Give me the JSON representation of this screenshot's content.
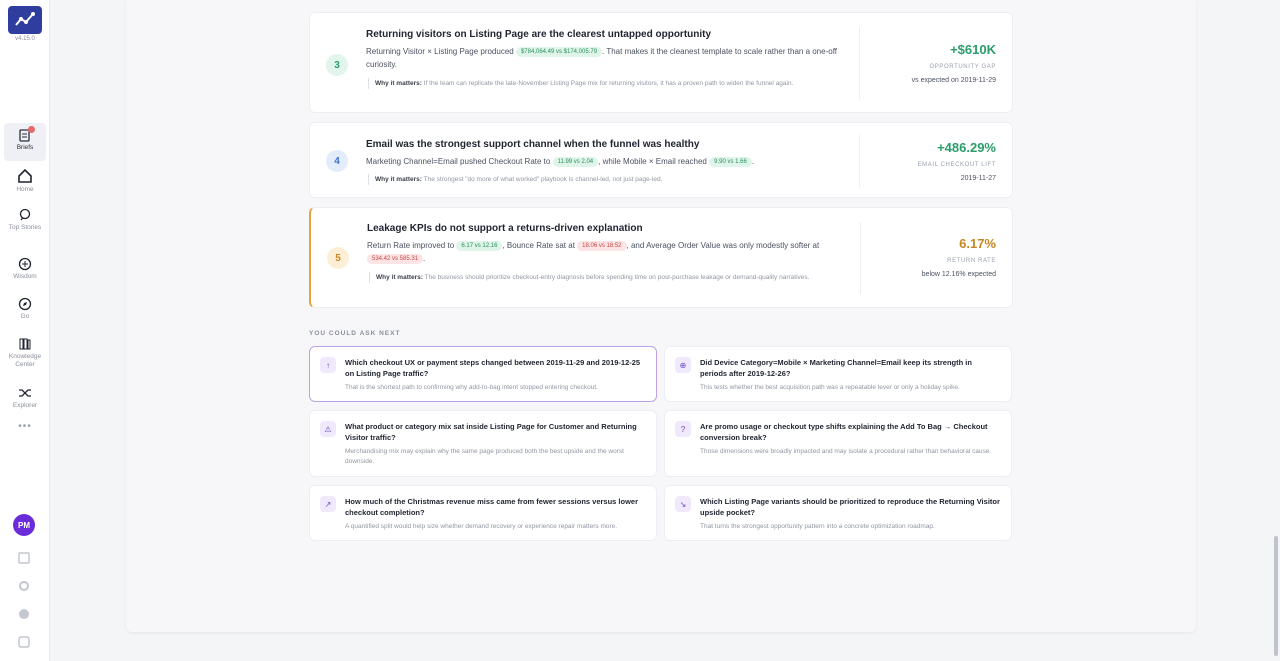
{
  "app": {
    "version": "v4.15.0",
    "user_initials": "PM"
  },
  "nav": [
    {
      "label": "Briefs",
      "icon": "briefs-icon"
    },
    {
      "label": "Home",
      "icon": "home-icon"
    },
    {
      "label": "Top Stories",
      "icon": "top-stories-icon"
    },
    {
      "label": "Wisdom",
      "icon": "wisdom-icon"
    },
    {
      "label": "Go",
      "icon": "compass-icon"
    },
    {
      "label": "Knowledge Center",
      "icon": "knowledge-center-icon"
    },
    {
      "label": "Explorer",
      "icon": "shuffle-icon"
    }
  ],
  "findings": [
    {
      "num": "3",
      "title": "Returning visitors on Listing Page are the clearest untapped opportunity",
      "body_a": "Returning Visitor × Listing Page produced",
      "pill_a": "$784,064.49 vs $174,005.79",
      "body_b": ". That makes it the cleanest template to scale rather than a one-off curiosity.",
      "why_label": "Why it matters:",
      "why_text": "If the team can replicate the late-November Listing Page mix for returning visitors, it has a proven path to widen the funnel again.",
      "metric_value": "+$610K",
      "metric_label": "OPPORTUNITY GAP",
      "metric_sub": "vs expected on 2019-11-29",
      "color": "#2a9d6a"
    },
    {
      "num": "4",
      "title": "Email was the strongest support channel when the funnel was healthy",
      "body_a": "Marketing Channel=Email pushed Checkout Rate to",
      "pill_a": "11.99 vs 2.04",
      "body_b": ", while Mobile × Email reached",
      "pill_b": "9.90 vs 1.66",
      "body_c": ".",
      "why_label": "Why it matters:",
      "why_text": "The strongest \"do more of what worked\" playbook is channel-led, not just page-led.",
      "metric_value": "+486.29%",
      "metric_label": "EMAIL CHECKOUT LIFT",
      "metric_sub": "2019-11-27",
      "color": "#2a9d6a"
    },
    {
      "num": "5",
      "title": "Leakage KPIs do not support a returns-driven explanation",
      "body_a": "Return Rate improved to",
      "pill_a": "6.17 vs 12.16",
      "body_b": ", Bounce Rate sat at",
      "pill_b": "18.06 vs 18.52",
      "body_c": ", and Average Order Value was only modestly softer at",
      "pill_c": "534.42 vs 585.31",
      "body_d": ".",
      "why_label": "Why it matters:",
      "why_text": "The business should prioritize checkout-entry diagnosis before spending time on post-purchase leakage or demand-quality narratives.",
      "metric_value": "6.17%",
      "metric_label": "RETURN RATE",
      "metric_sub": "below 12.16% expected",
      "color": "#c78620"
    }
  ],
  "ask_next": {
    "heading": "YOU COULD ASK NEXT",
    "questions": [
      {
        "icon": "↑",
        "title": "Which checkout UX or payment steps changed between 2019-11-29 and 2019-12-25 on Listing Page traffic?",
        "sub": "That is the shortest path to confirming why add-to-bag intent stopped entering checkout."
      },
      {
        "icon": "⊕",
        "title": "Did Device Category=Mobile × Marketing Channel=Email keep its strength in periods after 2019-12-26?",
        "sub": "This tests whether the best acquisition path was a repeatable lever or only a holiday spike."
      },
      {
        "icon": "⚠",
        "title": "What product or category mix sat inside Listing Page for Customer and Returning Visitor traffic?",
        "sub": "Merchandising mix may explain why the same page produced both the best upside and the worst downside."
      },
      {
        "icon": "?",
        "title": "Are promo usage or checkout type shifts explaining the Add To Bag → Checkout conversion break?",
        "sub": "Those dimensions were broadly impacted and may isolate a procedural rather than behavioral cause."
      },
      {
        "icon": "↗",
        "title": "How much of the Christmas revenue miss came from fewer sessions versus lower checkout completion?",
        "sub": "A quantified split would help size whether demand recovery or experience repair matters more."
      },
      {
        "icon": "↘",
        "title": "Which Listing Page variants should be prioritized to reproduce the Returning Visitor upside pocket?",
        "sub": "That turns the strongest opportunity pattern into a concrete optimization roadmap."
      }
    ]
  }
}
